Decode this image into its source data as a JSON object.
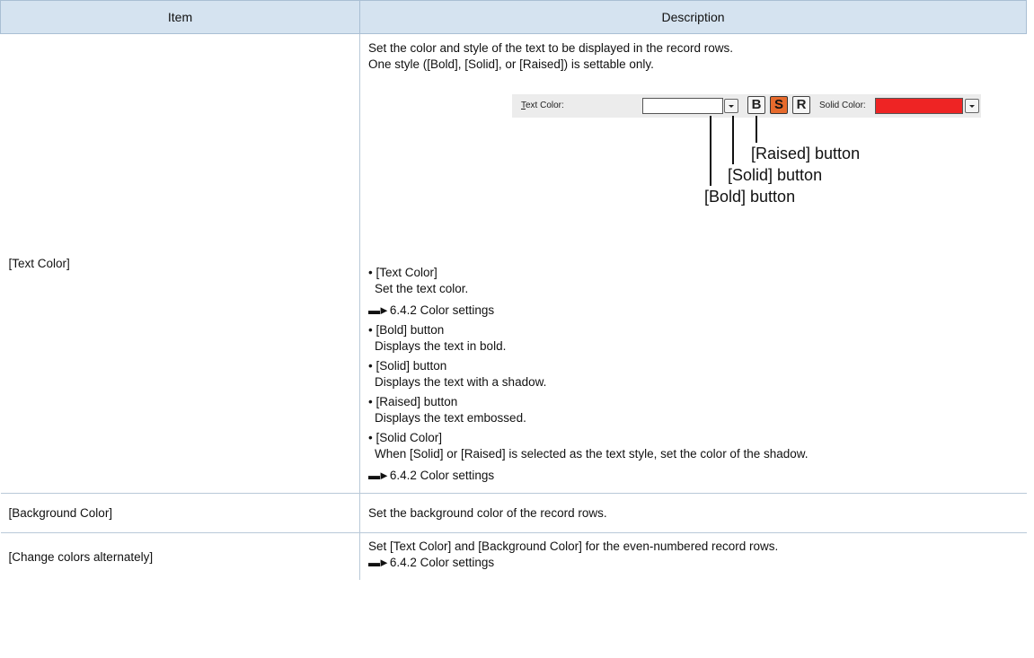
{
  "header": {
    "item": "Item",
    "description": "Description"
  },
  "row_text_color": {
    "item": "[Text Color]",
    "intro_1": "Set the color and style of the text to be displayed in the record rows.",
    "intro_2": "One style ([Bold], [Solid], or [Raised]) is settable only.",
    "figure": {
      "text_color_label_accel": "T",
      "text_color_label_rest": "ext Color:",
      "bold_btn": "B",
      "solid_btn": "S",
      "raised_btn": "R",
      "solid_color_label": "Solid Color:",
      "solid_color_value": "#ee2424",
      "solid_btn_color": "#e66a2c",
      "callout_raised": "[Raised] button",
      "callout_solid": "[Solid] button",
      "callout_bold": "[Bold] button"
    },
    "bullets": [
      {
        "title": "• [Text Color]",
        "desc": "Set the text color."
      },
      {
        "title": "• [Bold] button",
        "desc": "Displays the text in bold."
      },
      {
        "title": "• [Solid] button",
        "desc": "Displays the text with a shadow."
      },
      {
        "title": "• [Raised] button",
        "desc": "Displays the text embossed."
      },
      {
        "title": "• [Solid Color]",
        "desc": "When [Solid] or [Raised] is selected as the text style, set the color of the shadow."
      }
    ],
    "ref_arrow": "▬►",
    "ref_1": "6.4.2 Color settings",
    "ref_2": "6.4.2 Color settings"
  },
  "row_background_color": {
    "item": "[Background Color]",
    "description": "Set the background color of the record rows."
  },
  "row_alternate": {
    "item": "[Change colors alternately]",
    "description": "Set [Text Color] and [Background Color] for the even-numbered record rows.",
    "ref": "6.4.2 Color settings"
  }
}
